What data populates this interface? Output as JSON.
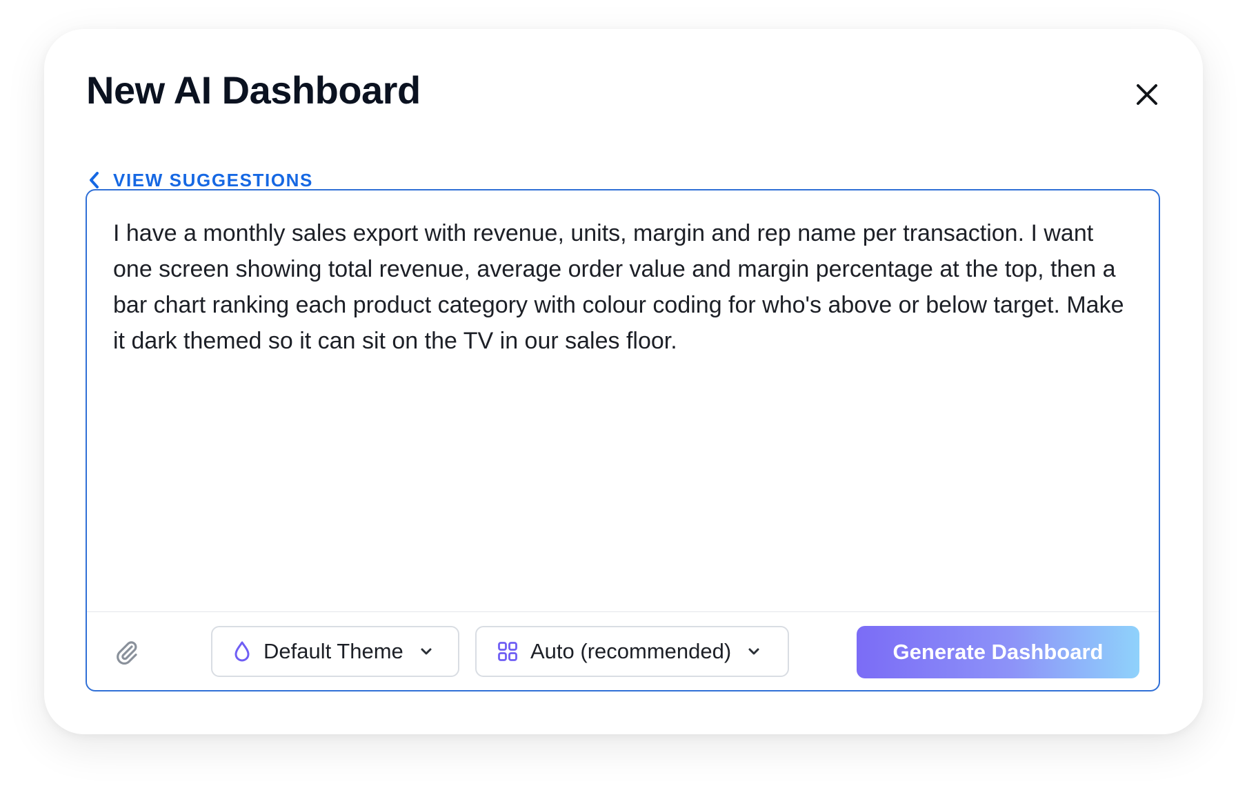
{
  "dialog": {
    "title": "New AI Dashboard",
    "close_icon": "close-icon",
    "suggestions_link": {
      "label": "VIEW SUGGESTIONS",
      "icon": "chevron-left-icon"
    }
  },
  "composer": {
    "prompt_value": "I have a monthly sales export with revenue, units, margin and rep name per transaction. I want one screen showing total revenue, average order value and margin percentage at the top, then a bar chart ranking each product category with colour coding for who's above or below target. Make it dark themed so it can sit on the TV in our sales floor.",
    "attach_icon": "paperclip-icon",
    "theme_select": {
      "label": "Default Theme",
      "icon": "droplet-icon",
      "caret_icon": "chevron-down-icon"
    },
    "layout_select": {
      "label": "Auto (recommended)",
      "icon": "grid-icon",
      "caret_icon": "chevron-down-icon"
    },
    "generate_button": {
      "label": "Generate Dashboard"
    }
  },
  "colors": {
    "title": "#0b1220",
    "link": "#1668e3",
    "composer_border": "#2f6fd6",
    "icon_purple": "#6f5ef4",
    "generate_gradient_start": "#7b6cf6",
    "generate_gradient_end": "#8fd2fb"
  }
}
